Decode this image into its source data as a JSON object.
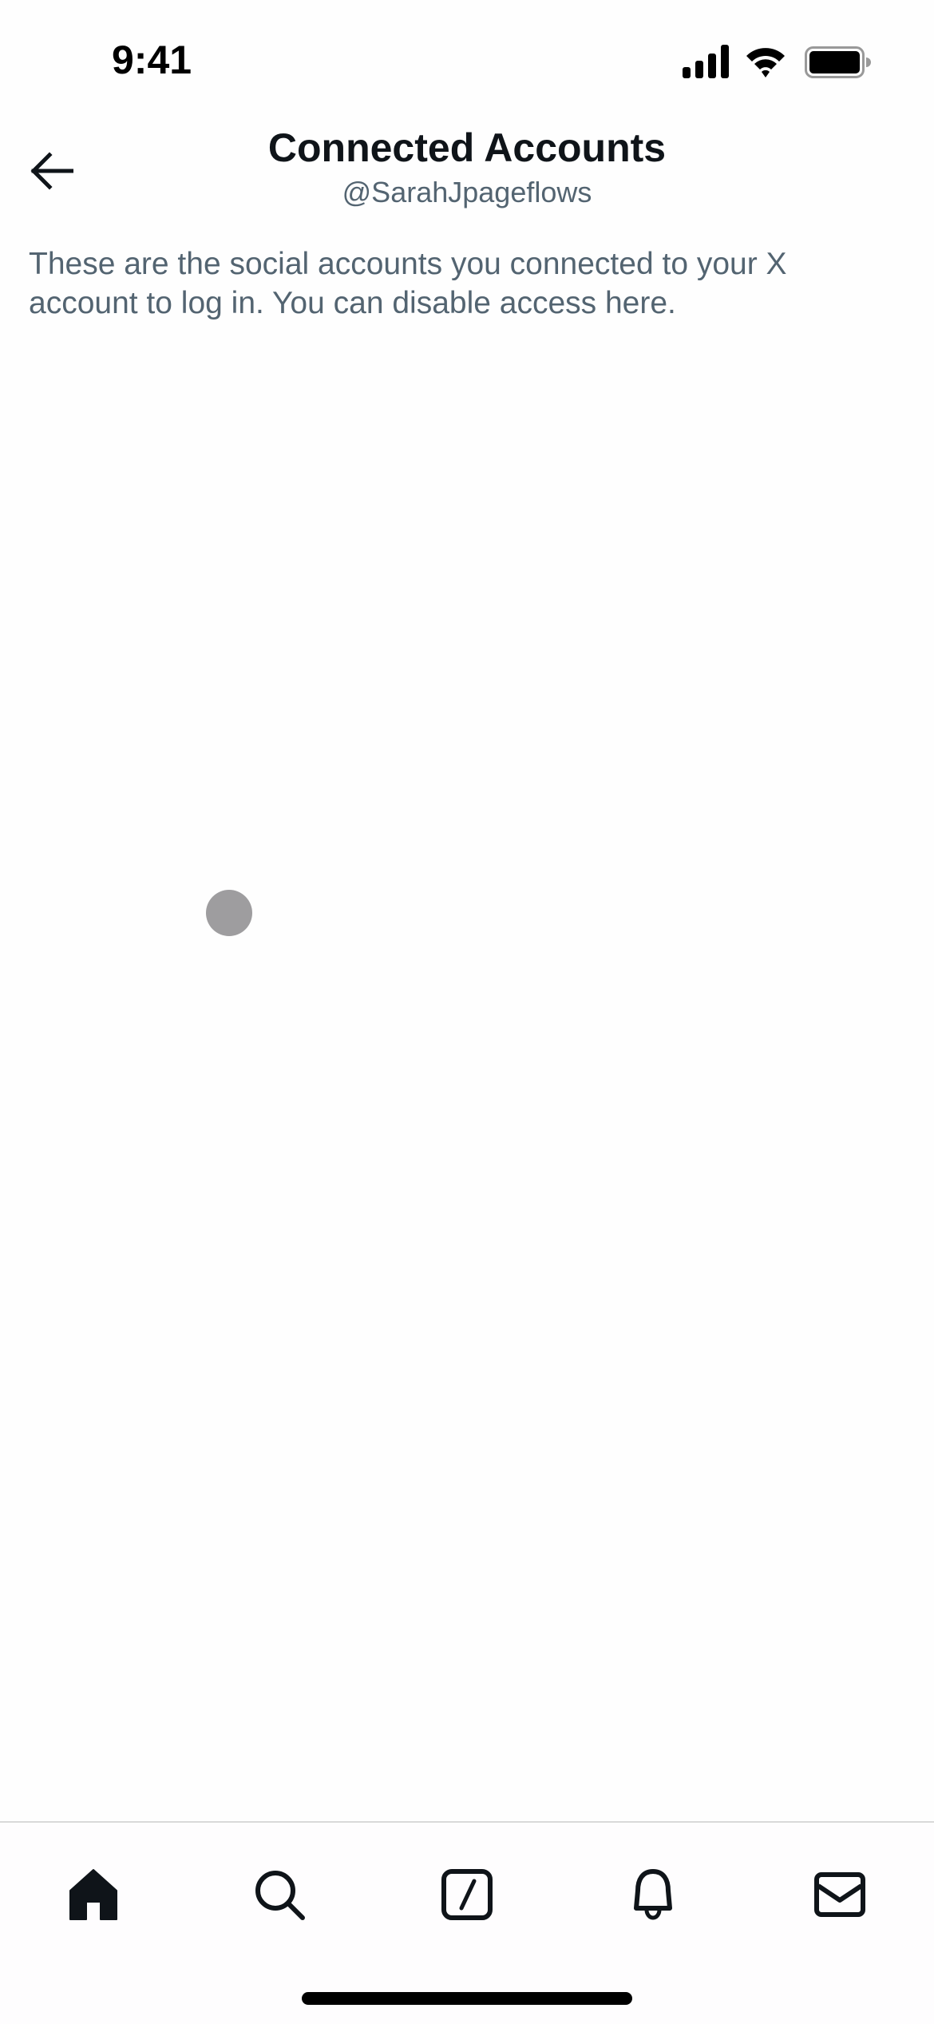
{
  "status_bar": {
    "time": "9:41",
    "icons": [
      "cellular-signal-icon",
      "wifi-icon",
      "battery-icon"
    ]
  },
  "header": {
    "back_icon": "arrow-left-icon",
    "title": "Connected Accounts",
    "subtitle": "@SarahJpageflows"
  },
  "main": {
    "description": "These are the social accounts you connected to your X account to log in. You can disable access here.",
    "loading_indicator": "loading-dot"
  },
  "tab_bar": {
    "tabs": [
      {
        "name": "home",
        "icon": "home-icon",
        "active": true
      },
      {
        "name": "search",
        "icon": "search-icon",
        "active": false
      },
      {
        "name": "compose",
        "icon": "compose-icon",
        "active": false
      },
      {
        "name": "notifications",
        "icon": "bell-icon",
        "active": false
      },
      {
        "name": "messages",
        "icon": "envelope-icon",
        "active": false
      }
    ]
  },
  "colors": {
    "primary_text": "#0f1419",
    "secondary_text": "#536471",
    "background": "#fefefe",
    "divider": "#d9d9d9",
    "loading_dot": "#9e9d9f"
  }
}
